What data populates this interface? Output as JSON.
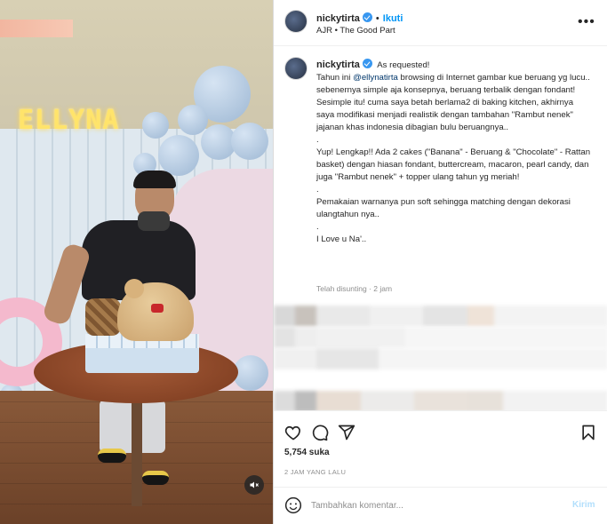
{
  "media": {
    "neon_sign": "ELLYNA",
    "mute_icon": "speaker-muted-icon"
  },
  "header": {
    "username": "nickytirta",
    "separator": "•",
    "follow_label": "Ikuti",
    "music_label": "AJR • The Good Part",
    "more_icon": "more-options-icon"
  },
  "caption": {
    "username": "nickytirta",
    "first_line": "As requested!",
    "p1_prefix": "Tahun ini ",
    "p1_mention": "@ellynatirta",
    "p1_suffix": " browsing di Internet gambar kue beruang yg lucu..",
    "p2": "sebenernya simple aja konsepnya, beruang terbalik dengan fondant! Sesimple itu! cuma saya betah berlama2 di baking kitchen, akhirnya saya modifikasi menjadi realistik dengan tambahan \"Rambut nenek\" jajanan khas indonesia dibagian bulu beruangnya..",
    "dot1": ".",
    "p3": "Yup! Lengkap!! Ada 2 cakes (\"Banana\" - Beruang & \"Chocolate\" - Rattan basket) dengan hiasan fondant, buttercream, macaron, pearl candy, dan juga \"Rambut nenek\" + topper ulang tahun yg meriah!",
    "dot2": ".",
    "p4": "Pemakaian warnanya pun soft sehingga matching dengan dekorasi ulangtahun nya..",
    "dot3": ".",
    "p5": "I Love u Na'..",
    "edited": "Telah disunting · 2 jam"
  },
  "actions": {
    "like_icon": "heart-icon",
    "comment_icon": "comment-icon",
    "share_icon": "share-icon",
    "save_icon": "bookmark-icon",
    "likes": "5,754 suka",
    "time_ago": "2 JAM YANG LALU"
  },
  "comment_box": {
    "emoji_icon": "emoji-icon",
    "placeholder": "Tambahkan komentar...",
    "post_label": "Kirim"
  },
  "colors": {
    "accent": "#0095f6",
    "post_disabled": "#b2dffc",
    "verified": "#3897f0"
  }
}
